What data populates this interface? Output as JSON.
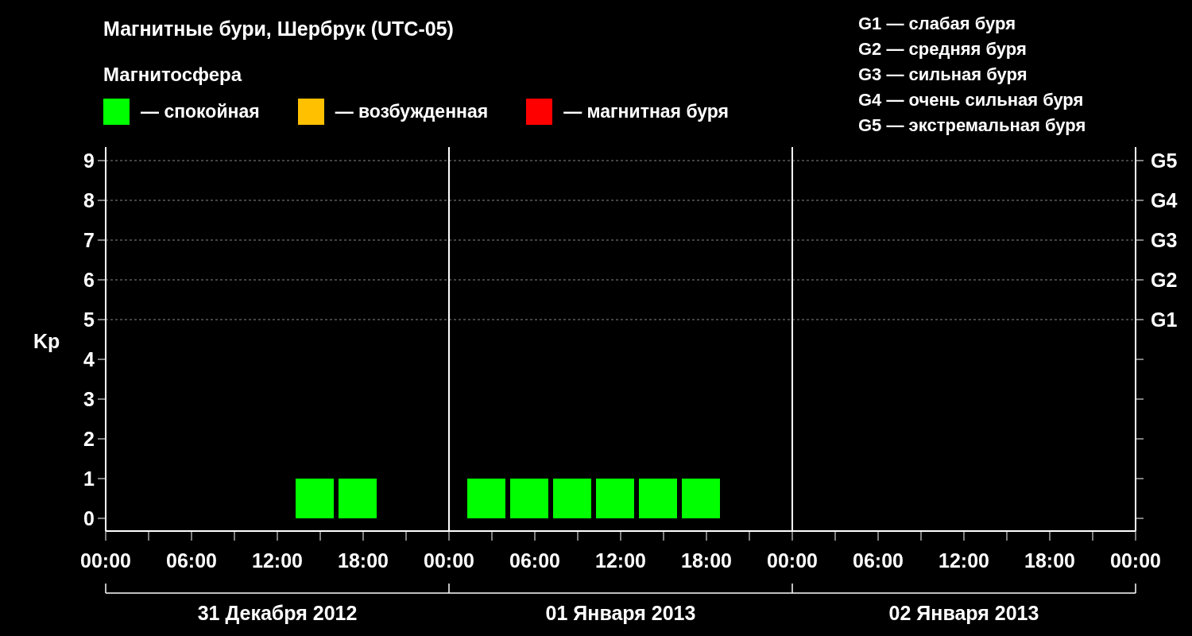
{
  "title": "Магнитные бури, Шербрук (UTC-05)",
  "legend": {
    "title": "Магнитосфера",
    "items": [
      {
        "label": "— спокойная",
        "color": "#00ff00"
      },
      {
        "label": "— возбужденная",
        "color": "#ffc000"
      },
      {
        "label": "— магнитная буря",
        "color": "#ff0000"
      }
    ]
  },
  "storm_scale": [
    "G1 — слабая буря",
    "G2 — средняя буря",
    "G3 — сильная буря",
    "G4 — очень сильная буря",
    "G5 — экстремальная буря"
  ],
  "chart_data": {
    "type": "bar",
    "ylabel": "Kp",
    "x": [
      "2012-12-31 14:30",
      "2012-12-31 17:30",
      "2013-01-01 02:30",
      "2013-01-01 05:30",
      "2013-01-01 08:30",
      "2013-01-01 11:30",
      "2013-01-01 14:30",
      "2013-01-01 17:30"
    ],
    "series": [
      {
        "color": "#00ff00",
        "values": [
          1,
          1,
          1,
          1,
          1,
          1,
          1,
          1
        ]
      }
    ],
    "xlim": [
      "2012-12-31 00:00",
      "2013-01-03 00:00"
    ],
    "ylim": [
      -0.32,
      9.34
    ],
    "xticks": [
      {
        "value": "2012-12-31 00:00",
        "label": "00:00"
      },
      {
        "value": "2012-12-31 06:00",
        "label": "06:00"
      },
      {
        "value": "2012-12-31 12:00",
        "label": "12:00"
      },
      {
        "value": "2012-12-31 18:00",
        "label": "18:00"
      },
      {
        "value": "2013-01-01 00:00",
        "label": "00:00"
      },
      {
        "value": "2013-01-01 06:00",
        "label": "06:00"
      },
      {
        "value": "2013-01-01 12:00",
        "label": "12:00"
      },
      {
        "value": "2013-01-01 18:00",
        "label": "18:00"
      },
      {
        "value": "2013-01-02 00:00",
        "label": "00:00"
      },
      {
        "value": "2013-01-02 06:00",
        "label": "06:00"
      },
      {
        "value": "2013-01-02 12:00",
        "label": "12:00"
      },
      {
        "value": "2013-01-02 18:00",
        "label": "18:00"
      },
      {
        "value": "2013-01-03 00:00",
        "label": "00:00"
      }
    ],
    "yticks": [
      0,
      1,
      2,
      3,
      4,
      5,
      6,
      7,
      8,
      9
    ],
    "grid": true,
    "annotations": [
      "G1",
      "G2",
      "G3",
      "G4",
      "G5"
    ]
  },
  "date_labels": [
    "31 Декабря 2012",
    "01 Января 2013",
    "02 Января 2013"
  ]
}
